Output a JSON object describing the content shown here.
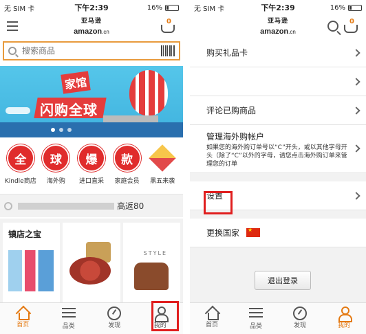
{
  "status": {
    "carrier": "无 SIM 卡",
    "time": "下午2:39",
    "battery": "16%"
  },
  "header": {
    "logo_cn": "亚马逊",
    "logo_en": "amazon",
    "logo_suffix": ".cn",
    "cart_count": "0"
  },
  "search": {
    "placeholder": "搜索商品"
  },
  "banner": {
    "tag": "家馆",
    "title": "闪购全球"
  },
  "categories": [
    {
      "icon": "全",
      "label": "Kindle商店"
    },
    {
      "icon": "球",
      "label": "海外购"
    },
    {
      "icon": "爆",
      "label": "进口直采"
    },
    {
      "icon": "款",
      "label": "家庭会员"
    },
    {
      "icon": "",
      "label": "黑五来袭"
    }
  ],
  "promo": {
    "text": "高返80"
  },
  "products": {
    "card1_title": "镇店之宝",
    "style_text": "STYLE"
  },
  "tabs": [
    {
      "label": "首页",
      "icon": "home-icon"
    },
    {
      "label": "品类",
      "icon": "list-icon"
    },
    {
      "label": "发现",
      "icon": "discover-icon"
    },
    {
      "label": "我的",
      "icon": "user-icon"
    }
  ],
  "settings": {
    "items": [
      {
        "label": "购买礼品卡"
      },
      {
        "label": ""
      },
      {
        "label": "评论已购商品"
      }
    ],
    "overseas": {
      "label": "管理海外购帐户",
      "desc": "如果您的海外购订单号以“C”开头，或以其他字母开头（除了“C”以外的字母，请您点击海外购订单来管理您的订单"
    },
    "settings_label": "设置",
    "country_label": "更换国家",
    "logout": "退出登录"
  },
  "colors": {
    "accent": "#e47911",
    "highlight": "#e01e1e",
    "search_border": "#e89a3c"
  }
}
